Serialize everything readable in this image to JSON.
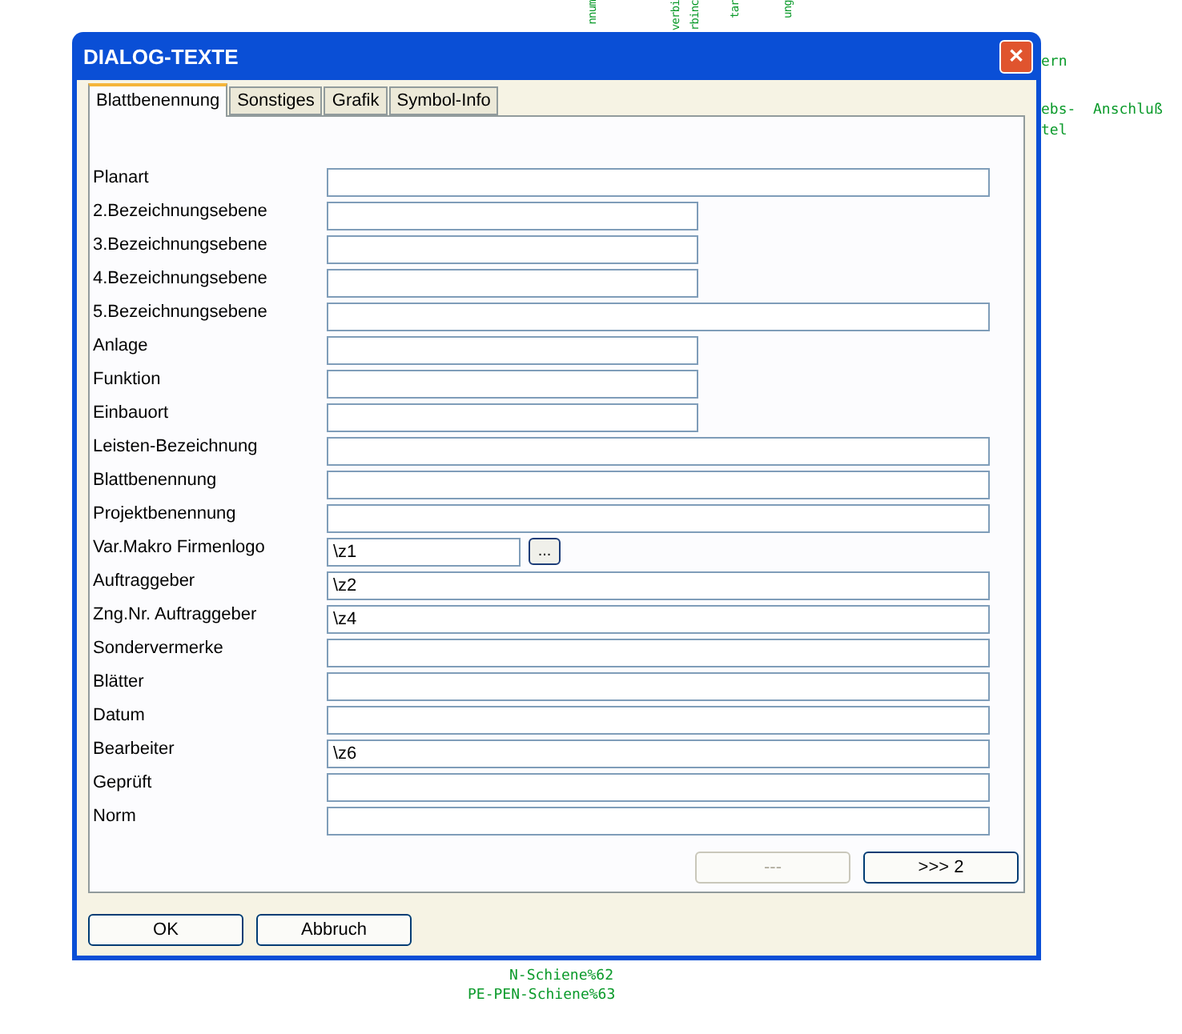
{
  "canvas_labels": [
    {
      "text": "nnum",
      "vertical": true
    },
    {
      "text": "verbi",
      "vertical": true
    },
    {
      "text": "rbinc",
      "vertical": true
    },
    {
      "text": "tar",
      "vertical": true
    },
    {
      "text": "ung",
      "vertical": true
    },
    {
      "text": "ern",
      "vertical": false
    },
    {
      "text": "ebs-  Anschluß",
      "vertical": false
    },
    {
      "text": "tel",
      "vertical": false
    },
    {
      "text": "N-Schiene%62",
      "vertical": false
    },
    {
      "text": "PE-PEN-Schiene%63",
      "vertical": false
    }
  ],
  "window": {
    "title": "DIALOG-TEXTE",
    "close": "✕"
  },
  "tabs": [
    {
      "label": "Blattbenennung",
      "selected": true
    },
    {
      "label": "Sonstiges",
      "selected": false
    },
    {
      "label": "Grafik",
      "selected": false
    },
    {
      "label": "Symbol-Info",
      "selected": false
    }
  ],
  "fields": [
    {
      "label": "Planart",
      "kind": "wide"
    },
    {
      "label": "2.Bezeichnungsebene",
      "kind": "short"
    },
    {
      "label": "3.Bezeichnungsebene",
      "kind": "short"
    },
    {
      "label": "4.Bezeichnungsebene",
      "kind": "short"
    },
    {
      "label": "5.Bezeichnungsebene",
      "kind": "wide"
    },
    {
      "label": "Anlage",
      "kind": "short"
    },
    {
      "label": "Funktion",
      "kind": "short"
    },
    {
      "label": "Einbauort",
      "kind": "short"
    },
    {
      "label": "Leisten-Bezeichnung",
      "kind": "wide"
    },
    {
      "label": "Blattbenennung",
      "kind": "wide"
    },
    {
      "label": "Projektbenennung",
      "kind": "wide"
    },
    {
      "label": "Var.Makro Firmenlogo",
      "kind": "browse",
      "value": "\\z1",
      "button": "..."
    },
    {
      "label": "Auftraggeber",
      "kind": "wide",
      "value": "\\z2"
    },
    {
      "label": "Zng.Nr. Auftraggeber",
      "kind": "wide",
      "value": "\\z4"
    },
    {
      "label": "Sondervermerke",
      "kind": "wide"
    },
    {
      "label": "Blätter",
      "kind": "wide"
    },
    {
      "label": "Datum",
      "kind": "wide"
    },
    {
      "label": "Bearbeiter",
      "kind": "wide",
      "value": "\\z6"
    },
    {
      "label": "Geprüft",
      "kind": "wide"
    },
    {
      "label": "Norm",
      "kind": "wide"
    }
  ],
  "page_buttons": [
    {
      "label": "---",
      "disabled": true
    },
    {
      "label": ">>> 2",
      "disabled": false
    }
  ],
  "buttons": [
    {
      "label": "OK"
    },
    {
      "label": "Abbruch"
    }
  ]
}
